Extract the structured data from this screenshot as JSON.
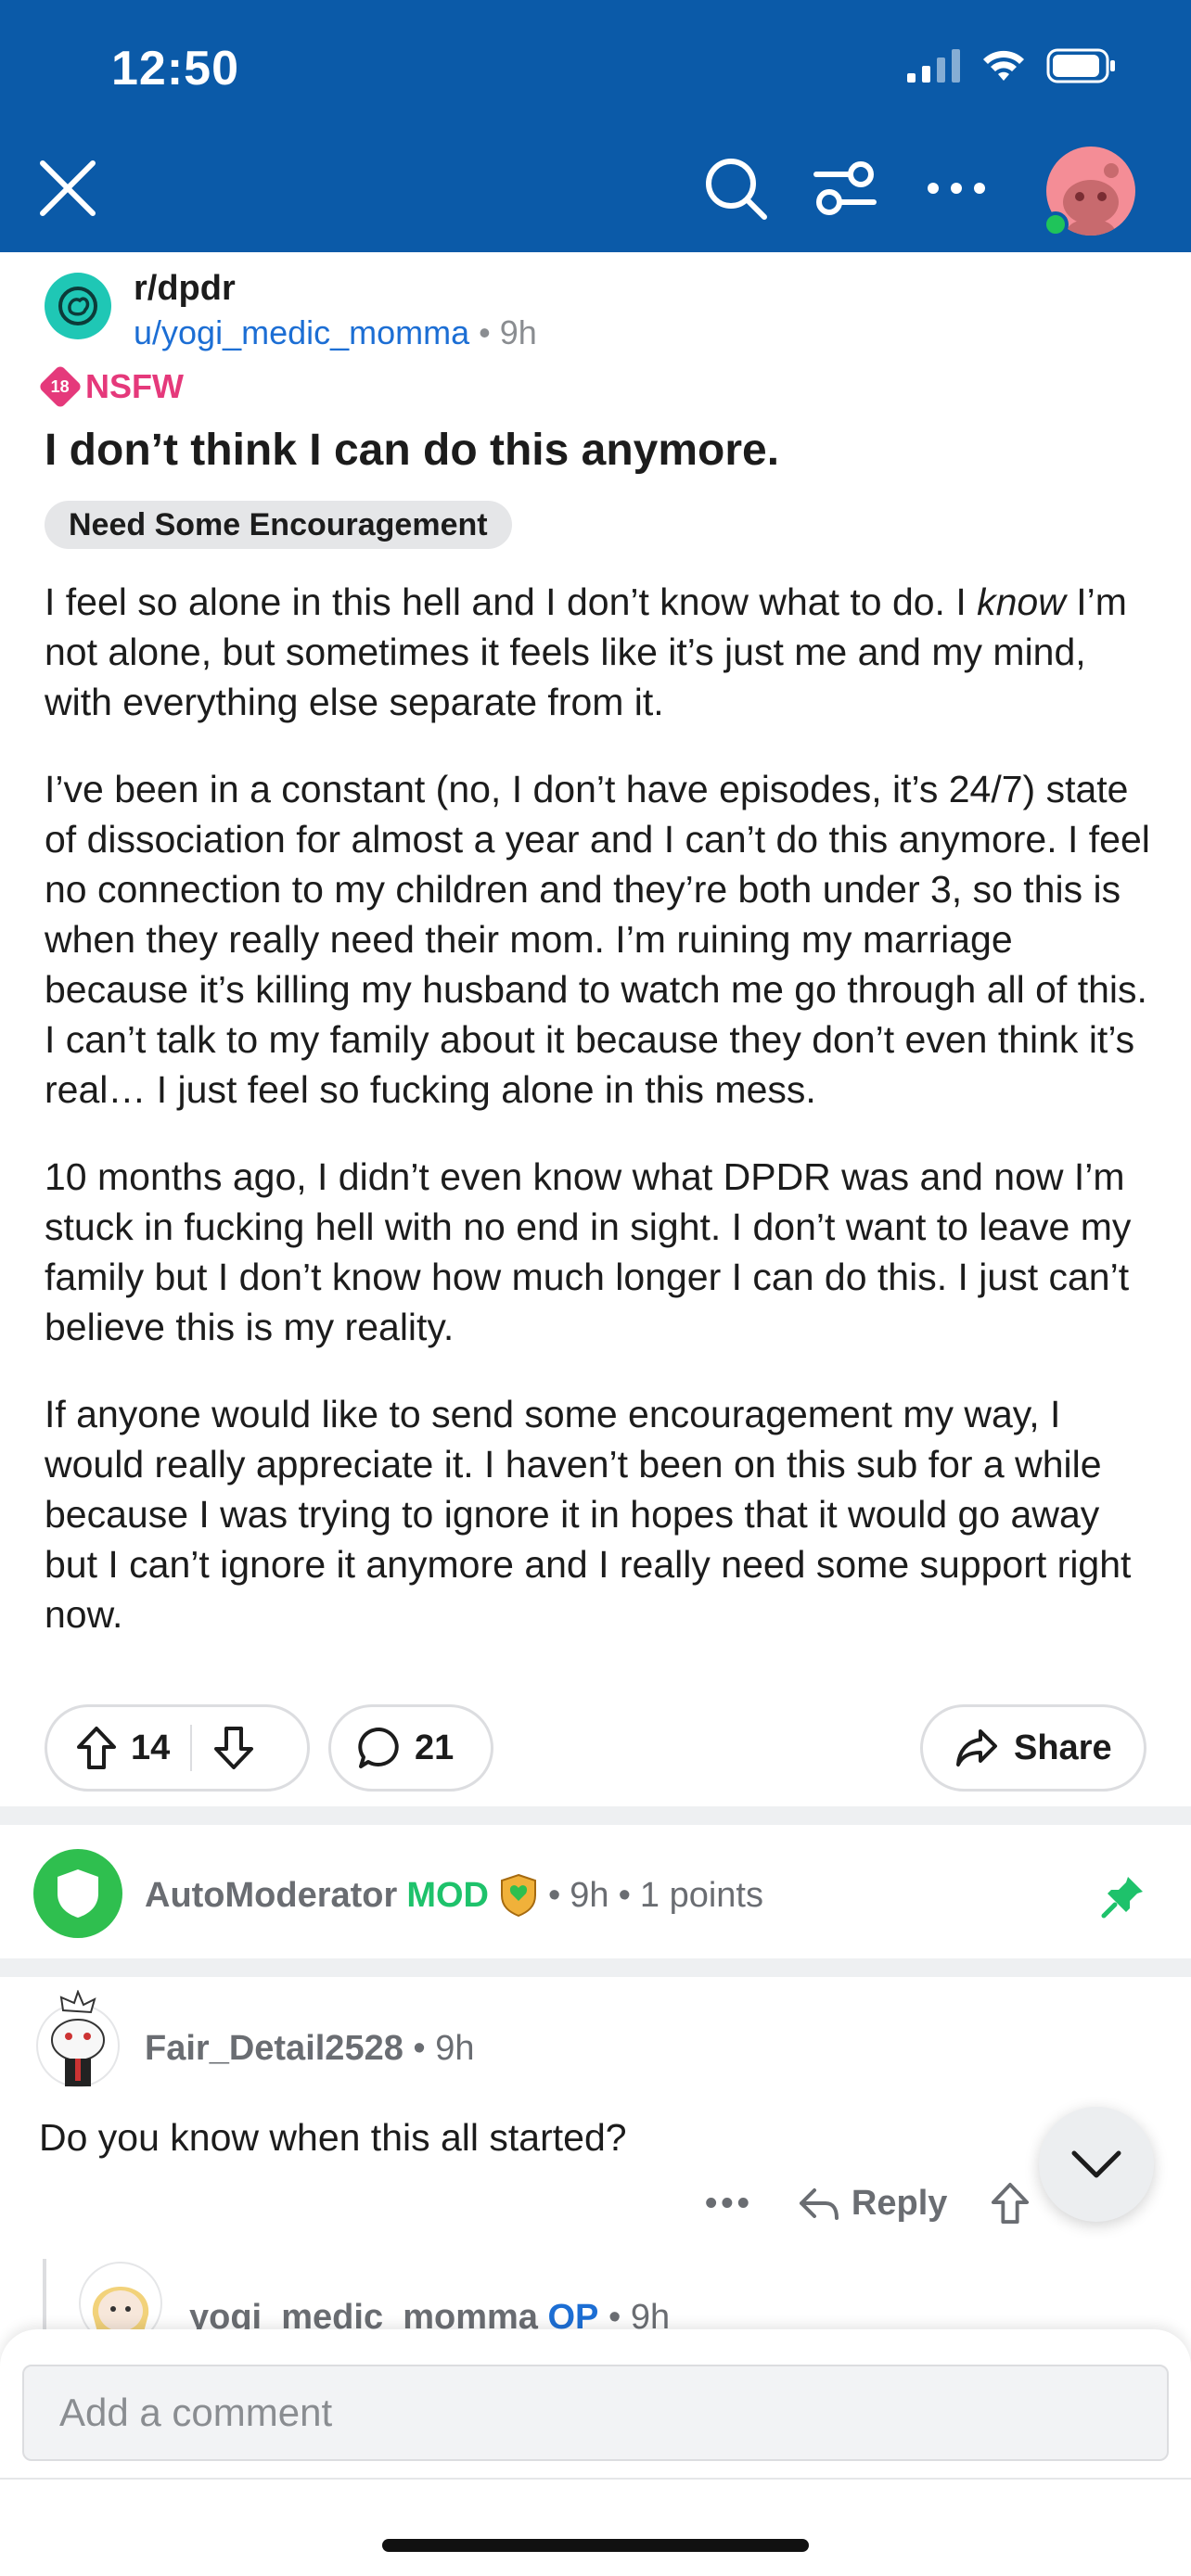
{
  "status_bar": {
    "time": "12:50"
  },
  "header": {
    "icons": [
      "close-icon",
      "search-icon",
      "filter-icon",
      "more-icon",
      "avatar"
    ],
    "background": "#0b5aa8"
  },
  "post": {
    "subreddit": "r/dpdr",
    "author": "u/yogi_medic_momma",
    "time": "9h",
    "nsfw_label": "NSFW",
    "nsfw_badge": "18",
    "title": "I don’t think I can do this anymore.",
    "flair": "Need Some Encouragement",
    "paragraph1_a": "I feel so alone in this hell and I don’t know what to do. I ",
    "paragraph1_em": "know",
    "paragraph1_b": " I’m not alone, but sometimes it feels like it’s just me and my mind, with everything else separate from it.",
    "paragraph2": "I’ve been in a constant (no, I don’t have episodes, it’s 24/7) state of dissociation for almost a year and I can’t do this anymore. I feel no connection to my children and they’re both under 3, so this is when they really need their mom. I’m ruining my marriage because it’s killing my husband to watch me go through all of this. I can’t talk to my family about it because they don’t even think it’s real… I just feel so fucking alone in this mess.",
    "paragraph3": "10 months ago, I didn’t even know what DPDR was and now I’m stuck in fucking hell with no end in sight. I don’t want to leave my family but I don’t know how much longer I can do this. I just can’t believe this is my reality.",
    "paragraph4": "If anyone would like to send some encouragement my way, I would really appreciate it. I haven’t been on this sub for a while because I was trying to ignore it in hopes that it would go away but I can’t ignore it anymore and I really need some support right now.",
    "score": "14",
    "comment_count": "21",
    "share_label": "Share"
  },
  "automod": {
    "username": "AutoModerator",
    "mod_label": "MOD",
    "time": "9h",
    "points": "1 points"
  },
  "comment": {
    "username": "Fair_Detail2528",
    "time": "9h",
    "text": "Do you know when this all started?",
    "more": "•••",
    "reply_label": "Reply"
  },
  "reply": {
    "username": "yogi_medic_momma",
    "op_label": "OP",
    "time": "9h"
  },
  "composer": {
    "placeholder": "Add a comment"
  },
  "colors": {
    "accent": "#1c6ed4",
    "nsfw": "#e5397b",
    "mod": "#1ec26b",
    "header": "#0b5aa8"
  }
}
